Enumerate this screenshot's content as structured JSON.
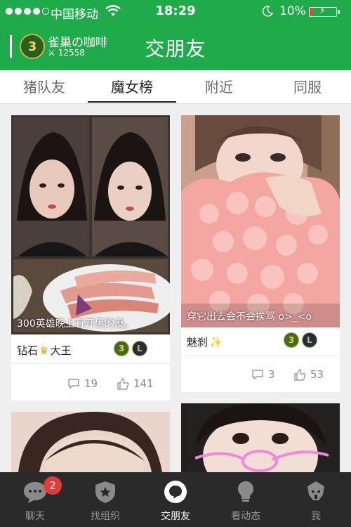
{
  "status_bar": {
    "carrier": "中国移动",
    "time": "18:29",
    "battery": "10%",
    "battery_level": 0.1
  },
  "header": {
    "user_name": "雀巢の咖啡",
    "user_score": "12558",
    "avatar_level": "3",
    "title": "交朋友"
  },
  "tabs": [
    {
      "label": "猪队友"
    },
    {
      "label": "魔女榜",
      "active": true
    },
    {
      "label": "附近"
    },
    {
      "label": "同服"
    }
  ],
  "cards": [
    {
      "caption": "300英雄晚上有开黑的没。",
      "name_prefix": "钻石",
      "name_suffix": "大王",
      "level_badge": "3",
      "lol_badge": "L",
      "comments": "19",
      "likes": "141"
    },
    {
      "caption": "穿它出去会不会挨骂 o>_<o",
      "name_prefix": "魅刹",
      "name_suffix": "",
      "level_badge": "3",
      "lol_badge": "L",
      "comments": "3",
      "likes": "53"
    }
  ],
  "tabbar": [
    {
      "label": "聊天",
      "badge": "2"
    },
    {
      "label": "找组织"
    },
    {
      "label": "交朋友",
      "active": true
    },
    {
      "label": "看动态"
    },
    {
      "label": "我"
    }
  ],
  "colors": {
    "brand_green": "#20ab4a",
    "badge_red": "#e33a3a",
    "tabbar_bg": "#2a2a2a"
  }
}
